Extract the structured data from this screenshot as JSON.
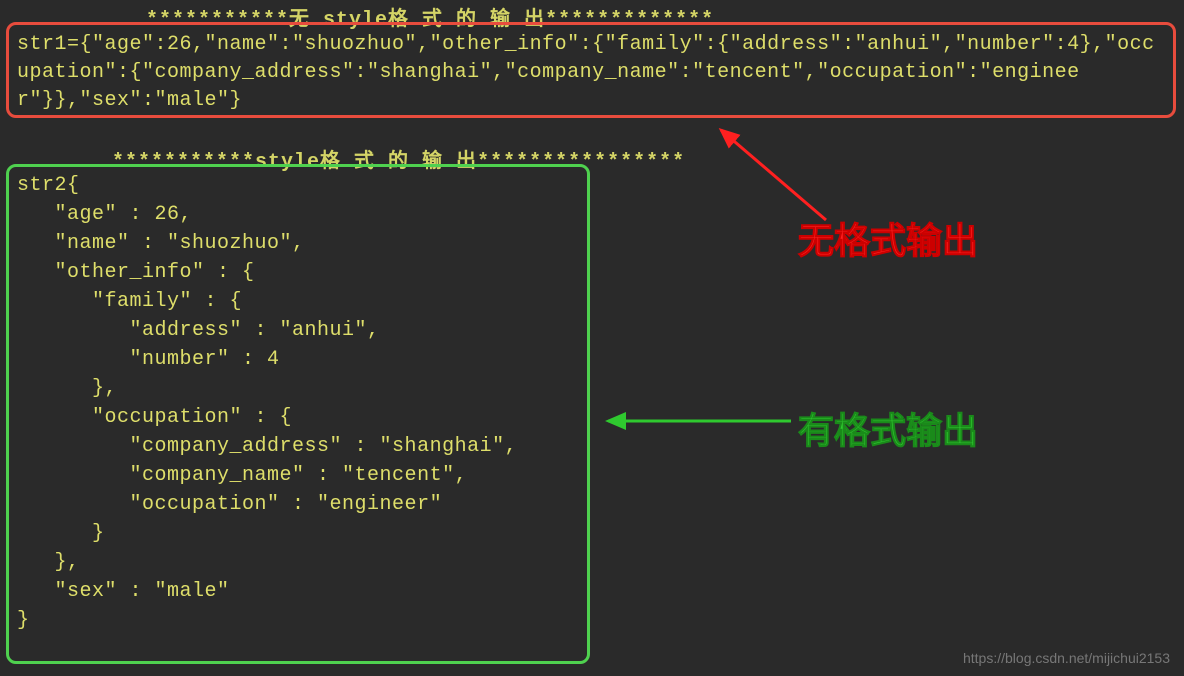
{
  "header1": "无 style格 式 的 输 出",
  "header2": "style格 式 的 输 出",
  "box1_text": "str1={\"age\":26,\"name\":\"shuozhuo\",\"other_info\":{\"family\":{\"address\":\"anhui\",\"number\":4},\"occupation\":{\"company_address\":\"shanghai\",\"company_name\":\"tencent\",\"occupation\":\"engineer\"}},\"sex\":\"male\"}",
  "box2_text": "str2{\n   \"age\" : 26,\n   \"name\" : \"shuozhuo\",\n   \"other_info\" : {\n      \"family\" : {\n         \"address\" : \"anhui\",\n         \"number\" : 4\n      },\n      \"occupation\" : {\n         \"company_address\" : \"shanghai\",\n         \"company_name\" : \"tencent\",\n         \"occupation\" : \"engineer\"\n      }\n   },\n   \"sex\" : \"male\"\n}",
  "label1": "无格式输出",
  "label2": "有格式输出",
  "watermark": "https://blog.csdn.net/mijichui2153",
  "stars": "***********",
  "stars_end": "*************",
  "stars2_end": "****************"
}
